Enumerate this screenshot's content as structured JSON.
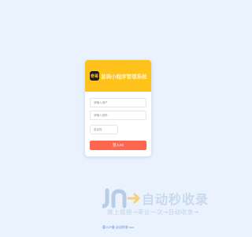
{
  "app": {
    "logo_text": "奇哥",
    "title": "皇骑小程序管理系统"
  },
  "login_form": {
    "username_placeholder": "请输入用户",
    "password_placeholder": "请输入密码",
    "captcha_placeholder": "验证码",
    "login_label": "登入02"
  },
  "watermark": {
    "title": "自动秒收录",
    "tagline": "做上链接→来访一次→自动收录→"
  },
  "footer": {
    "text": "冀 ICP备 自动秒收 xxx"
  },
  "colors": {
    "background": "#eaf3fd",
    "header": "#ffc21a",
    "button": "#ff6650"
  }
}
